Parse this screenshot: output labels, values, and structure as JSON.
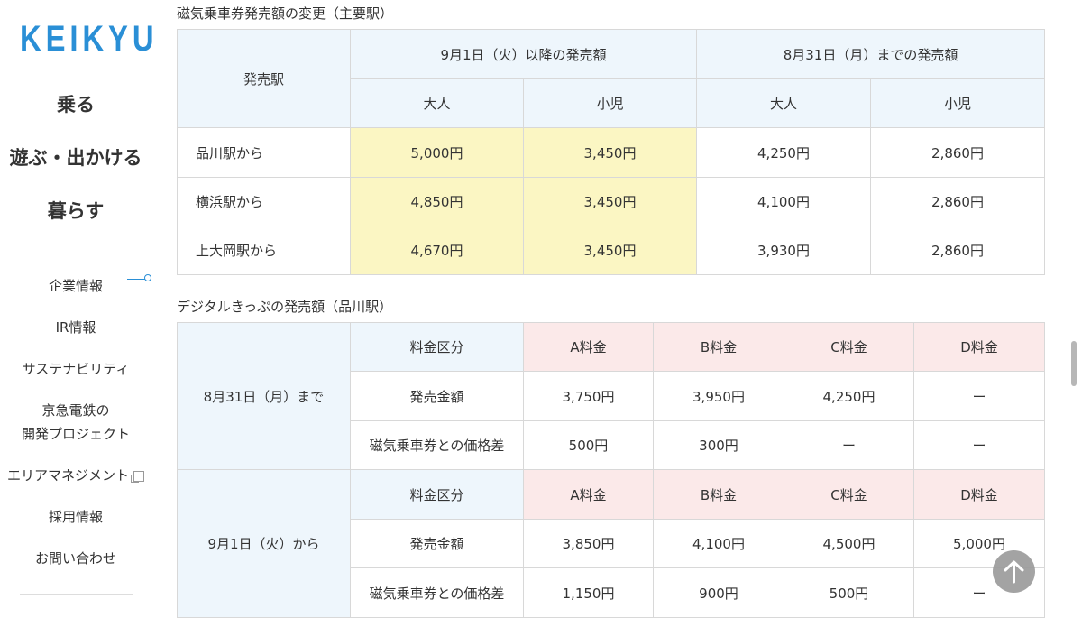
{
  "brand": {
    "logo_text": "KEIKYU",
    "accent": "#2a8fd6"
  },
  "main_nav": [
    "乗る",
    "遊ぶ・出かける",
    "暮らす"
  ],
  "sub_nav": [
    {
      "label": [
        "企業情報"
      ],
      "active": true
    },
    {
      "label": [
        "IR情報"
      ]
    },
    {
      "label": [
        "サステナビリティ"
      ]
    },
    {
      "label": [
        "京急電鉄の",
        "開発プロジェクト"
      ]
    },
    {
      "label": [
        "エリアマネジメント"
      ],
      "external": true
    },
    {
      "label": [
        "採用情報"
      ]
    },
    {
      "label": [
        "お問い合わせ"
      ]
    }
  ],
  "table1": {
    "caption": "磁気乗車券発売額の変更（主要駅）",
    "station_header": "発売駅",
    "group_new": "9月1日（火）以降の発売額",
    "group_old": "8月31日（月）までの発売額",
    "adult": "大人",
    "child": "小児",
    "rows": [
      {
        "station": "品川駅から",
        "new_adult": "5,000円",
        "new_child": "3,450円",
        "old_adult": "4,250円",
        "old_child": "2,860円"
      },
      {
        "station": "横浜駅から",
        "new_adult": "4,850円",
        "new_child": "3,450円",
        "old_adult": "4,100円",
        "old_child": "2,860円"
      },
      {
        "station": "上大岡駅から",
        "new_adult": "4,670円",
        "new_child": "3,450円",
        "old_adult": "3,930円",
        "old_child": "2,860円"
      }
    ]
  },
  "table2": {
    "caption": "デジタルきっぷの発売額（品川駅）",
    "blocks": [
      {
        "period": "8月31日（月）まで",
        "category_label": "料金区分",
        "categories": [
          "A料金",
          "B料金",
          "C料金",
          "D料金"
        ],
        "price_label": "発売金額",
        "prices": [
          "3,750円",
          "3,950円",
          "4,250円",
          "ー"
        ],
        "diff_label": "磁気乗車券との価格差",
        "diffs": [
          "500円",
          "300円",
          "ー",
          "ー"
        ]
      },
      {
        "period": "9月1日（火）から",
        "category_label": "料金区分",
        "categories": [
          "A料金",
          "B料金",
          "C料金",
          "D料金"
        ],
        "price_label": "発売金額",
        "prices": [
          "3,850円",
          "4,100円",
          "4,500円",
          "5,000円"
        ],
        "diff_label": "磁気乗車券との価格差",
        "diffs": [
          "1,150円",
          "900円",
          "500円",
          "ー"
        ]
      }
    ]
  }
}
